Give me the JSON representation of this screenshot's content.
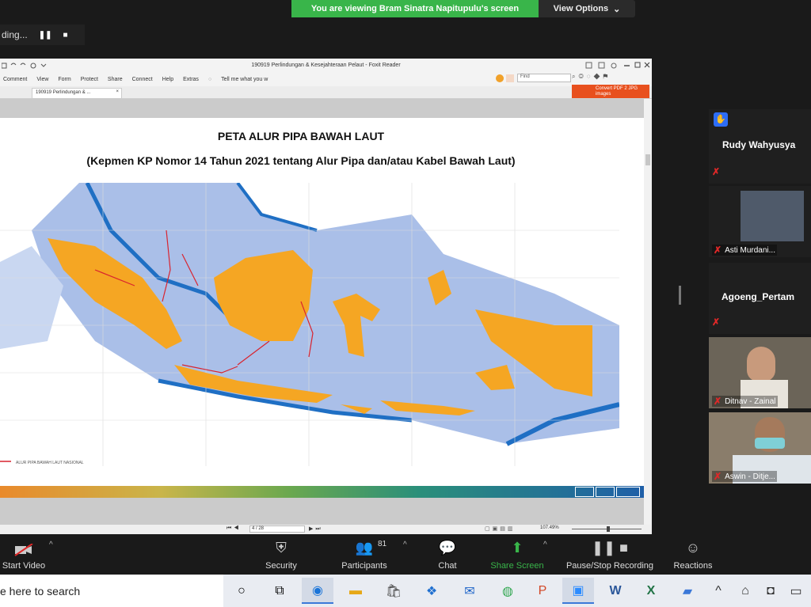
{
  "banner": {
    "message": "You are viewing Bram Sinatra Napitupulu's screen",
    "options_label": "View Options",
    "options_caret": "⌄"
  },
  "recording": {
    "label": "ding...",
    "pause_glyph": "❚❚",
    "stop_glyph": "■"
  },
  "reader": {
    "window_title": "190919 Perlindungan & Kesejahteraan Pelaut - Foxit Reader",
    "menu": [
      "Comment",
      "View",
      "Form",
      "Protect",
      "Share",
      "Connect",
      "Help",
      "Extras"
    ],
    "tell_me": "Tell me what you w",
    "find_placeholder": "Find",
    "tab_label": "190919 Perlindungan & ...",
    "convert_label": "Convert PDF 2 JPG images",
    "page_input": "4 / 28",
    "zoom_level": "107.49%"
  },
  "document": {
    "title_line1": "PETA ALUR PIPA BAWAH LAUT",
    "title_line2": "(Kepmen KP Nomor 14 Tahun 2021 tentang Alur Pipa dan/atau Kabel Bawah Laut)",
    "legend_text": "ALUR PIPA BAWAH LAUT NASIONAL"
  },
  "participants": [
    {
      "name": "Rudy  Wahyusya",
      "muted": true,
      "has_hand": true
    },
    {
      "name": "Asti Murdani...",
      "muted": true
    },
    {
      "name": "Agoeng_Pertam",
      "muted": true
    },
    {
      "name": "Ditnav - Zainal",
      "muted": true
    },
    {
      "name": "Aswin - Ditje...",
      "muted": true
    }
  ],
  "toolbar": {
    "start_video": "Start Video",
    "security": "Security",
    "participants_label": "Participants",
    "participants_count": "81",
    "chat": "Chat",
    "share_screen": "Share Screen",
    "record": "Pause/Stop Recording",
    "reactions": "Reactions"
  },
  "taskbar": {
    "search_placeholder": "e here to search"
  },
  "colors": {
    "banner_green": "#39b54a",
    "land_orange": "#f5a623",
    "shallow_blue": "#aabfe8",
    "deep_blue": "#1f6fc4",
    "share_green": "#39b54a"
  }
}
